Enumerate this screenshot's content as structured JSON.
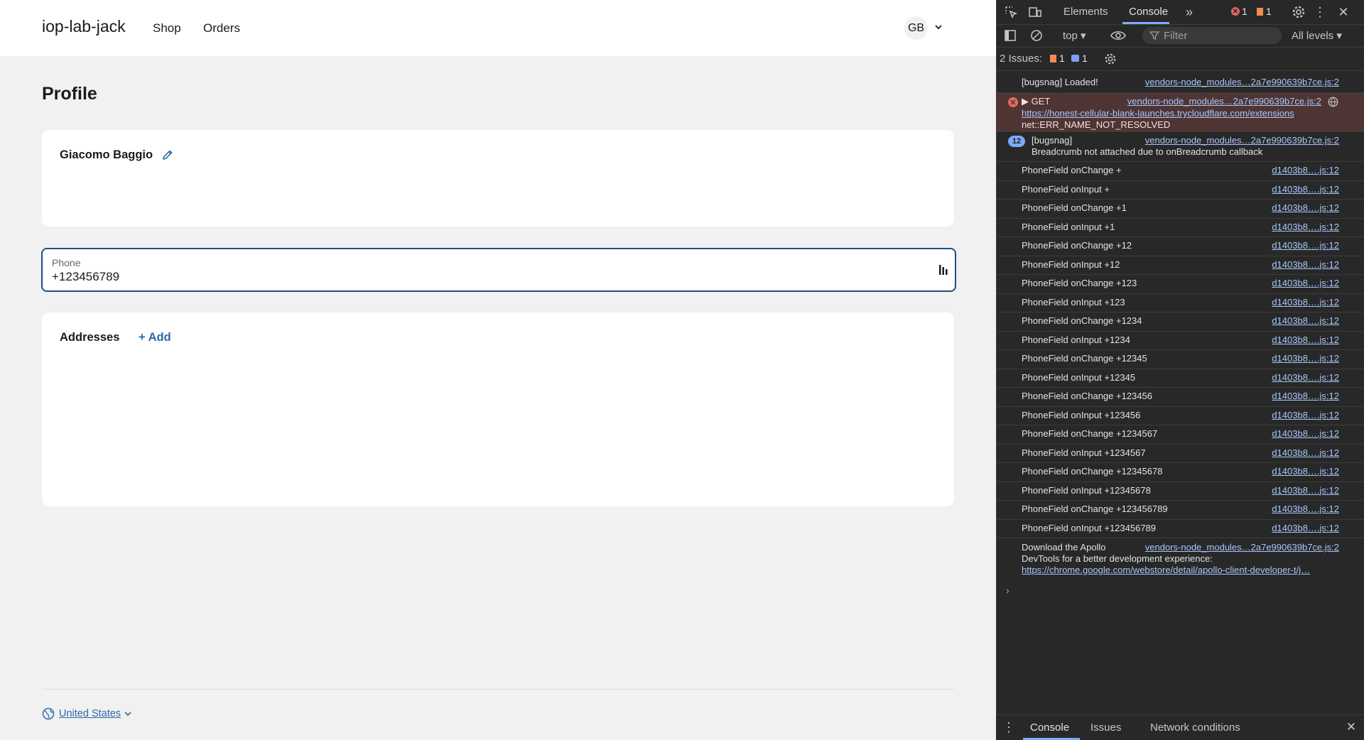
{
  "app": {
    "brand": "iop-lab-jack",
    "nav": [
      "Shop",
      "Orders"
    ],
    "avatar_initials": "GB",
    "page_title": "Profile",
    "name": "Giacomo Baggio",
    "phone": {
      "label": "Phone",
      "value": "+123456789"
    },
    "addresses": {
      "title": "Addresses",
      "add_label": "+ Add"
    },
    "footer": {
      "country": "United States"
    }
  },
  "devtools": {
    "tabs": {
      "elements": "Elements",
      "console": "Console"
    },
    "counts": {
      "errors": "1",
      "warnings": "1"
    },
    "context": "top ▾",
    "filter_placeholder": "Filter",
    "levels": "All levels ▾",
    "issues": {
      "label": "2 Issues:",
      "warnings": "1",
      "info": "1"
    },
    "logs": [
      {
        "msg": "[bugsnag] Loaded!",
        "src": "vendors-node_modules…2a7e990639b7ce.js:2"
      },
      {
        "type": "error",
        "msg": "▶ GET",
        "src": "vendors-node_modules…2a7e990639b7ce.js:2",
        "url": "https://honest-cellular-blank-launches.trycloudflare.com/extensions",
        "detail": "net::ERR_NAME_NOT_RESOLVED"
      },
      {
        "repeat": "12",
        "msg": "[bugsnag]",
        "src": "vendors-node_modules…2a7e990639b7ce.js:2",
        "detail": "Breadcrumb not attached due to onBreadcrumb callback"
      },
      {
        "msg": "PhoneField onChange +",
        "src": "d1403b8….js:12"
      },
      {
        "msg": "PhoneField onInput +",
        "src": "d1403b8….js:12"
      },
      {
        "msg": "PhoneField onChange +1",
        "src": "d1403b8….js:12"
      },
      {
        "msg": "PhoneField onInput +1",
        "src": "d1403b8….js:12"
      },
      {
        "msg": "PhoneField onChange +12",
        "src": "d1403b8….js:12"
      },
      {
        "msg": "PhoneField onInput +12",
        "src": "d1403b8….js:12"
      },
      {
        "msg": "PhoneField onChange +123",
        "src": "d1403b8….js:12"
      },
      {
        "msg": "PhoneField onInput +123",
        "src": "d1403b8….js:12"
      },
      {
        "msg": "PhoneField onChange +1234",
        "src": "d1403b8….js:12"
      },
      {
        "msg": "PhoneField onInput +1234",
        "src": "d1403b8….js:12"
      },
      {
        "msg": "PhoneField onChange +12345",
        "src": "d1403b8….js:12"
      },
      {
        "msg": "PhoneField onInput +12345",
        "src": "d1403b8….js:12"
      },
      {
        "msg": "PhoneField onChange +123456",
        "src": "d1403b8….js:12"
      },
      {
        "msg": "PhoneField onInput +123456",
        "src": "d1403b8….js:12"
      },
      {
        "msg": "PhoneField onChange +1234567",
        "src": "d1403b8….js:12"
      },
      {
        "msg": "PhoneField onInput +1234567",
        "src": "d1403b8….js:12"
      },
      {
        "msg": "PhoneField onChange +12345678",
        "src": "d1403b8….js:12"
      },
      {
        "msg": "PhoneField onInput +12345678",
        "src": "d1403b8….js:12"
      },
      {
        "msg": "PhoneField onChange +123456789",
        "src": "d1403b8….js:12"
      },
      {
        "msg": "PhoneField onInput +123456789",
        "src": "d1403b8….js:12"
      },
      {
        "msg": "Download the Apollo",
        "src": "vendors-node_modules…2a7e990639b7ce.js:2",
        "detail": "DevTools for a better development experience:",
        "url": "https://chrome.google.com/webstore/detail/apollo-client-developer-t/j…"
      }
    ],
    "prompt": "›",
    "bottom_tabs": [
      "Console",
      "Issues",
      "Network conditions"
    ]
  }
}
